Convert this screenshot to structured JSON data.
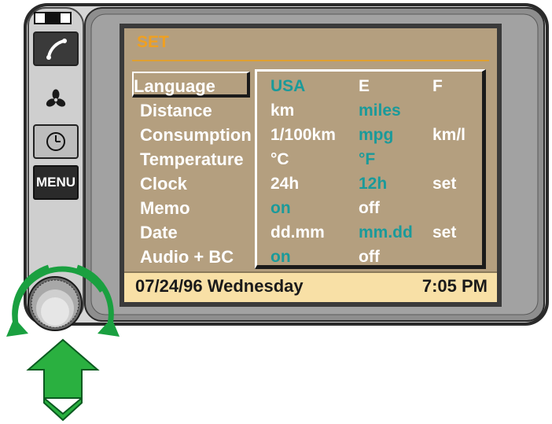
{
  "screen": {
    "title": "SET",
    "menu": [
      {
        "label": "Language",
        "selected": true
      },
      {
        "label": "Distance"
      },
      {
        "label": "Consumption"
      },
      {
        "label": "Temperature"
      },
      {
        "label": "Clock"
      },
      {
        "label": "Memo"
      },
      {
        "label": "Date"
      },
      {
        "label": "Audio + BC"
      }
    ],
    "options": [
      [
        {
          "text": "USA",
          "color": "teal"
        },
        {
          "text": "E",
          "color": "white"
        },
        {
          "text": "F",
          "color": "white"
        }
      ],
      [
        {
          "text": "km",
          "color": "white"
        },
        {
          "text": "miles",
          "color": "teal"
        }
      ],
      [
        {
          "text": "1/100km",
          "color": "white"
        },
        {
          "text": "mpg",
          "color": "teal"
        },
        {
          "text": "km/l",
          "color": "white"
        }
      ],
      [
        {
          "text": "°C",
          "color": "white"
        },
        {
          "text": "°F",
          "color": "teal"
        }
      ],
      [
        {
          "text": "24h",
          "color": "white"
        },
        {
          "text": "12h",
          "color": "teal"
        },
        {
          "text": "set",
          "color": "white"
        }
      ],
      [
        {
          "text": "on",
          "color": "teal"
        },
        {
          "text": "off",
          "color": "white"
        }
      ],
      [
        {
          "text": "dd.mm",
          "color": "white"
        },
        {
          "text": "mm.dd",
          "color": "teal"
        },
        {
          "text": "set",
          "color": "white"
        }
      ],
      [
        {
          "text": "on",
          "color": "teal"
        },
        {
          "text": "off",
          "color": "white"
        }
      ]
    ],
    "status": {
      "date": "07/24/96 Wednesday",
      "time": "7:05 PM"
    }
  },
  "controls": {
    "menu_label": "MENU",
    "phone_icon": "phone-icon",
    "fan_icon": "fan-icon",
    "clock_icon": "clock-icon",
    "knob": "rotary-knob",
    "rotate_arrows": "rotate-arrows-icon",
    "push_arrow": "push-arrow-icon"
  },
  "colors": {
    "screen_bg": "#b49f7f",
    "title": "#f0a020",
    "accent_option": "#1a9a9a",
    "status_bg": "#f8e0a6",
    "arrow_green": "#1aa040"
  }
}
